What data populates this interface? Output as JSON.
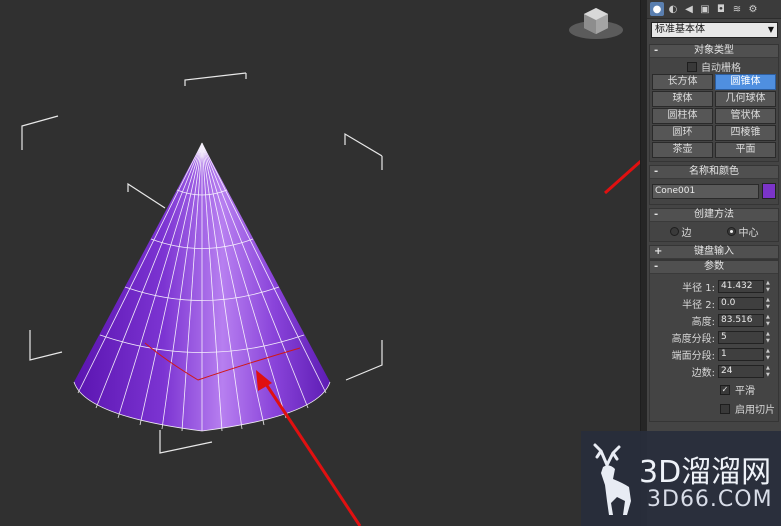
{
  "panel": {
    "tab_icons": [
      "geometry-icon",
      "shapes-icon",
      "lights-icon",
      "cameras-icon",
      "helpers-icon",
      "spacewarps-icon",
      "systems-icon"
    ],
    "category_dropdown": "标准基本体",
    "object_type": {
      "title": "对象类型",
      "autogrid_label": "自动栅格",
      "buttons": [
        "长方体",
        "圆锥体",
        "球体",
        "几何球体",
        "圆柱体",
        "管状体",
        "圆环",
        "四棱锥",
        "茶壶",
        "平面"
      ],
      "selected": "圆锥体"
    },
    "name_color": {
      "title": "名称和颜色",
      "object_name": "Cone001",
      "color": "#7b34c8"
    },
    "creation_method": {
      "title": "创建方法",
      "options": [
        "边",
        "中心"
      ],
      "selected": "中心"
    },
    "keyboard_entry": {
      "title": "键盘输入"
    },
    "parameters": {
      "title": "参数",
      "fields": [
        {
          "label": "半径 1:",
          "value": "41.432"
        },
        {
          "label": "半径 2:",
          "value": "0.0"
        },
        {
          "label": "高度:",
          "value": "83.516"
        },
        {
          "label": "高度分段:",
          "value": "5"
        },
        {
          "label": "端面分段:",
          "value": "1"
        },
        {
          "label": "边数:",
          "value": "24"
        }
      ],
      "smooth_label": "平滑",
      "smooth_checked": "✓",
      "slice_label": "启用切片"
    }
  },
  "viewport": {
    "object_color": "#8a3fd6",
    "annotation_color": "#e01010"
  },
  "watermark": {
    "title": "3D溜溜网",
    "subtitle": "3D66.COM"
  }
}
